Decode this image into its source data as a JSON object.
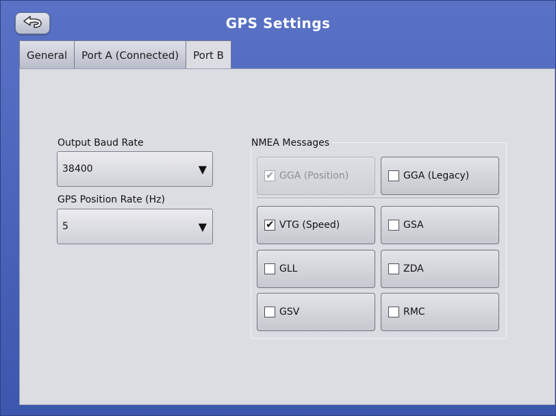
{
  "header": {
    "title": "GPS Settings",
    "back_icon": "back-arrow-icon"
  },
  "tabs": [
    {
      "label": "General",
      "active": false
    },
    {
      "label": "Port A (Connected)",
      "active": false
    },
    {
      "label": "Port B",
      "active": true
    }
  ],
  "output_baud_rate": {
    "label": "Output Baud Rate",
    "value": "38400"
  },
  "gps_position_rate": {
    "label": "GPS Position Rate (Hz)",
    "value": "5"
  },
  "nmea": {
    "title": "NMEA Messages",
    "items": [
      {
        "label": "GGA (Position)",
        "checked": true,
        "disabled": true
      },
      {
        "label": "GGA (Legacy)",
        "checked": false,
        "disabled": false
      },
      {
        "label": "VTG (Speed)",
        "checked": true,
        "disabled": false
      },
      {
        "label": "GSA",
        "checked": false,
        "disabled": false
      },
      {
        "label": "GLL",
        "checked": false,
        "disabled": false
      },
      {
        "label": "ZDA",
        "checked": false,
        "disabled": false
      },
      {
        "label": "GSV",
        "checked": false,
        "disabled": false
      },
      {
        "label": "RMC",
        "checked": false,
        "disabled": false
      }
    ]
  },
  "colors": {
    "title_bar": "#4a62b4",
    "panel": "#dcdde3"
  }
}
